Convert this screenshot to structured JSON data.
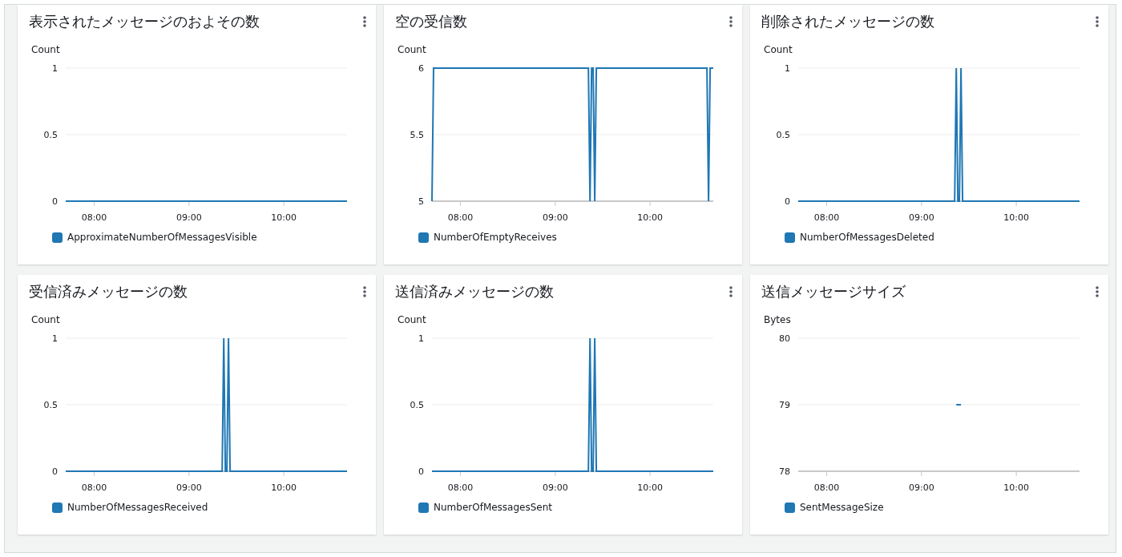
{
  "widgets": [
    {
      "title": "表示されたメッセージのおよその数",
      "chart_data": {
        "type": "line",
        "ylabel": "Count",
        "x": [
          462,
          463,
          561,
          562,
          563,
          564,
          565,
          566,
          636,
          637,
          638,
          640
        ],
        "xlim": [
          462,
          640
        ],
        "ylim": [
          0,
          1
        ],
        "xticks": [
          {
            "value": 480,
            "label": "08:00"
          },
          {
            "value": 540,
            "label": "09:00"
          },
          {
            "value": 600,
            "label": "10:00"
          }
        ],
        "yticks": [
          0,
          0.5,
          1
        ],
        "series": [
          {
            "name": "ApproximateNumberOfMessagesVisible",
            "color": "#1f77b4",
            "values": [
              0,
              0,
              0,
              0,
              0,
              0,
              0,
              0,
              0,
              0,
              0,
              0
            ]
          }
        ]
      }
    },
    {
      "title": "空の受信数",
      "chart_data": {
        "type": "line",
        "ylabel": "Count",
        "x": [
          462,
          463,
          561,
          562,
          563,
          564,
          565,
          566,
          636,
          637,
          638,
          640
        ],
        "xlim": [
          462,
          640
        ],
        "ylim": [
          5,
          6
        ],
        "xticks": [
          {
            "value": 480,
            "label": "08:00"
          },
          {
            "value": 540,
            "label": "09:00"
          },
          {
            "value": 600,
            "label": "10:00"
          }
        ],
        "yticks": [
          5,
          5.5,
          6
        ],
        "series": [
          {
            "name": "NumberOfEmptyReceives",
            "color": "#1f77b4",
            "values": [
              5,
              6,
              6,
              5,
              6,
              6,
              5,
              6,
              6,
              5,
              6,
              6
            ]
          }
        ]
      }
    },
    {
      "title": "削除されたメッセージの数",
      "chart_data": {
        "type": "line",
        "ylabel": "Count",
        "x": [
          462,
          463,
          561,
          562,
          563,
          564,
          565,
          566,
          636,
          637,
          638,
          640
        ],
        "xlim": [
          462,
          640
        ],
        "ylim": [
          0,
          1
        ],
        "xticks": [
          {
            "value": 480,
            "label": "08:00"
          },
          {
            "value": 540,
            "label": "09:00"
          },
          {
            "value": 600,
            "label": "10:00"
          }
        ],
        "yticks": [
          0,
          0.5,
          1
        ],
        "series": [
          {
            "name": "NumberOfMessagesDeleted",
            "color": "#1f77b4",
            "values": [
              0,
              0,
              0,
              1,
              0,
              0,
              1,
              0,
              0,
              0,
              0,
              0
            ]
          }
        ]
      }
    },
    {
      "title": "受信済みメッセージの数",
      "chart_data": {
        "type": "line",
        "ylabel": "Count",
        "x": [
          462,
          463,
          561,
          562,
          563,
          564,
          565,
          566,
          636,
          637,
          638,
          640
        ],
        "xlim": [
          462,
          640
        ],
        "ylim": [
          0,
          1
        ],
        "xticks": [
          {
            "value": 480,
            "label": "08:00"
          },
          {
            "value": 540,
            "label": "09:00"
          },
          {
            "value": 600,
            "label": "10:00"
          }
        ],
        "yticks": [
          0,
          0.5,
          1
        ],
        "series": [
          {
            "name": "NumberOfMessagesReceived",
            "color": "#1f77b4",
            "values": [
              0,
              0,
              0,
              1,
              0,
              0,
              1,
              0,
              0,
              0,
              0,
              0
            ]
          }
        ]
      }
    },
    {
      "title": "送信済みメッセージの数",
      "chart_data": {
        "type": "line",
        "ylabel": "Count",
        "x": [
          462,
          463,
          561,
          562,
          563,
          564,
          565,
          566,
          636,
          637,
          638,
          640
        ],
        "xlim": [
          462,
          640
        ],
        "ylim": [
          0,
          1
        ],
        "xticks": [
          {
            "value": 480,
            "label": "08:00"
          },
          {
            "value": 540,
            "label": "09:00"
          },
          {
            "value": 600,
            "label": "10:00"
          }
        ],
        "yticks": [
          0,
          0.5,
          1
        ],
        "series": [
          {
            "name": "NumberOfMessagesSent",
            "color": "#1f77b4",
            "values": [
              0,
              0,
              0,
              1,
              0,
              0,
              1,
              0,
              0,
              0,
              0,
              0
            ]
          }
        ]
      }
    },
    {
      "title": "送信メッセージサイズ",
      "chart_data": {
        "type": "line",
        "ylabel": "Bytes",
        "x": [
          562,
          565
        ],
        "xlim": [
          462,
          640
        ],
        "ylim": [
          78,
          80
        ],
        "xticks": [
          {
            "value": 480,
            "label": "08:00"
          },
          {
            "value": 540,
            "label": "09:00"
          },
          {
            "value": 600,
            "label": "10:00"
          }
        ],
        "yticks": [
          78,
          79,
          80
        ],
        "series": [
          {
            "name": "SentMessageSize",
            "color": "#1f77b4",
            "values": [
              79,
              79
            ]
          }
        ]
      }
    }
  ]
}
